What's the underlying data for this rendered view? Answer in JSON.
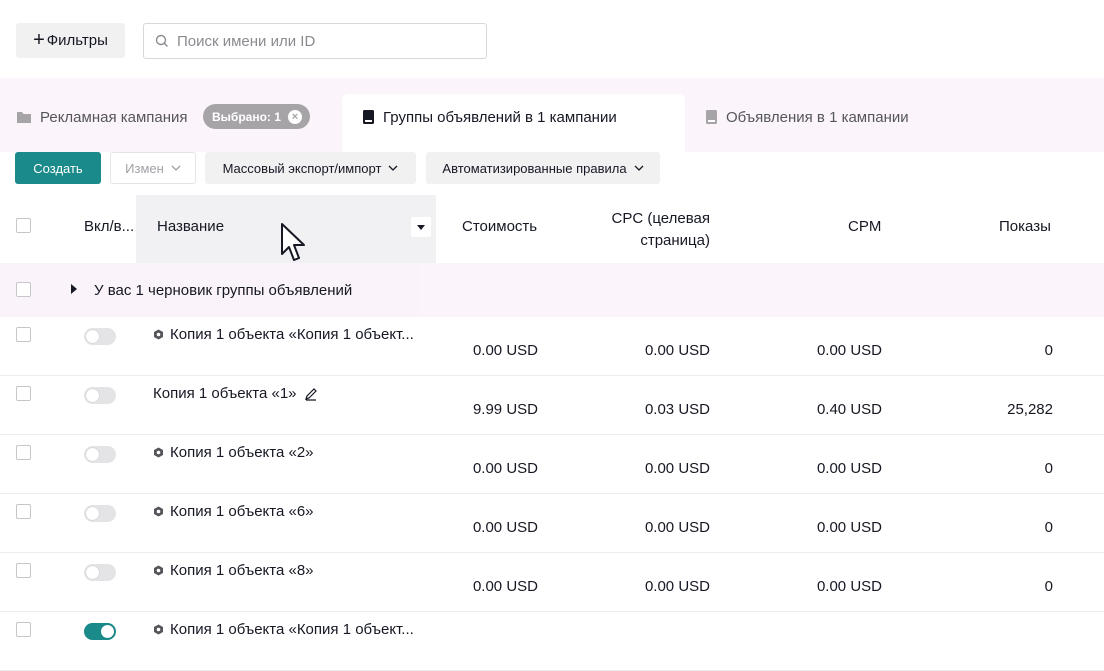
{
  "top": {
    "filter_label": "Фильтры",
    "search_placeholder": "Поиск имени или ID"
  },
  "tabs": {
    "campaign": "Рекламная кампания",
    "selected_badge": "Выбрано: 1",
    "groups": "Группы объявлений в 1 кампании",
    "ads": "Объявления в 1 кампании"
  },
  "toolbar": {
    "create": "Создать",
    "edit": "Измен",
    "export": "Массовый экспорт/импорт",
    "auto_rules": "Автоматизированные правила"
  },
  "columns": {
    "onoff": "Вкл/в...",
    "name": "Название",
    "cost": "Стоимость",
    "cpc_line1": "CPC (целевая",
    "cpc_line2": "страница)",
    "cpm": "CPM",
    "impressions": "Показы"
  },
  "draft": "У вас 1 черновик группы объявлений",
  "rows": [
    {
      "name": "Копия 1 объекта «Копия 1 объект...",
      "cost": "0.00 USD",
      "cpc": "0.00 USD",
      "cpm": "0.00 USD",
      "impressions": "0",
      "on": false
    },
    {
      "name": "Копия 1 объекта «1»",
      "cost": "9.99 USD",
      "cpc": "0.03 USD",
      "cpm": "0.40 USD",
      "impressions": "25,282",
      "on": false
    },
    {
      "name": "Копия 1 объекта «2»",
      "cost": "0.00 USD",
      "cpc": "0.00 USD",
      "cpm": "0.00 USD",
      "impressions": "0",
      "on": false
    },
    {
      "name": "Копия 1 объекта «6»",
      "cost": "0.00 USD",
      "cpc": "0.00 USD",
      "cpm": "0.00 USD",
      "impressions": "0",
      "on": false
    },
    {
      "name": "Копия 1 объекта «8»",
      "cost": "0.00 USD",
      "cpc": "0.00 USD",
      "cpm": "0.00 USD",
      "impressions": "0",
      "on": false
    },
    {
      "name": "Копия 1 объекта «Копия 1 объект...",
      "cost": "",
      "cpc": "",
      "cpm": "",
      "impressions": "",
      "on": true
    }
  ],
  "colors": {
    "accent": "#1a8a8a",
    "tab_bg": "#fbf4fb"
  }
}
